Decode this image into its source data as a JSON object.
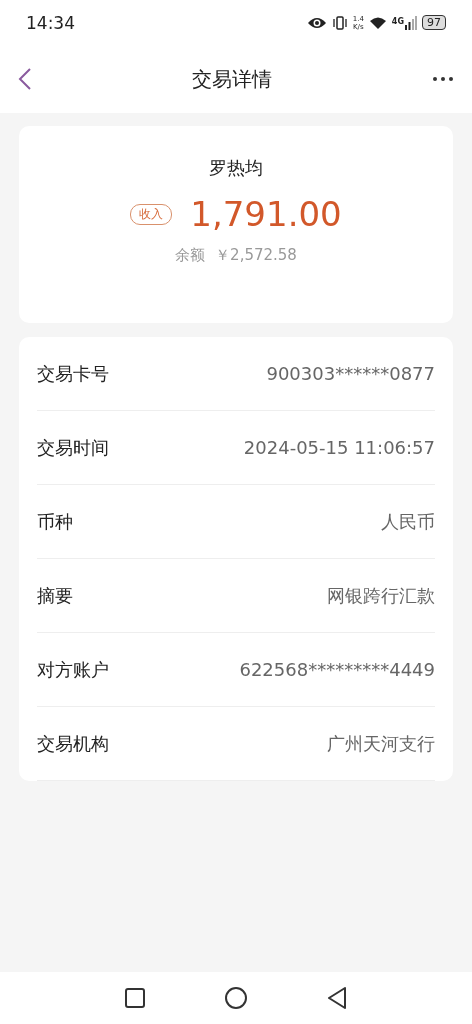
{
  "status_bar": {
    "time": "14:34",
    "net_speed": [
      "1.4",
      "K/s"
    ],
    "network": "4G",
    "battery": "97"
  },
  "header": {
    "title": "交易详情"
  },
  "summary": {
    "name": "罗热均",
    "tag": "收入",
    "amount": "1,791.00",
    "balance_label": "余额",
    "balance": "￥2,572.58"
  },
  "details": [
    {
      "label": "交易卡号",
      "value": "900303******0877"
    },
    {
      "label": "交易时间",
      "value": "2024-05-15 11:06:57"
    },
    {
      "label": "币种",
      "value": "人民币"
    },
    {
      "label": "摘要",
      "value": "网银跨行汇款"
    },
    {
      "label": "对方账户",
      "value": "622568*********4449"
    },
    {
      "label": "交易机构",
      "value": "广州天河支行"
    }
  ]
}
